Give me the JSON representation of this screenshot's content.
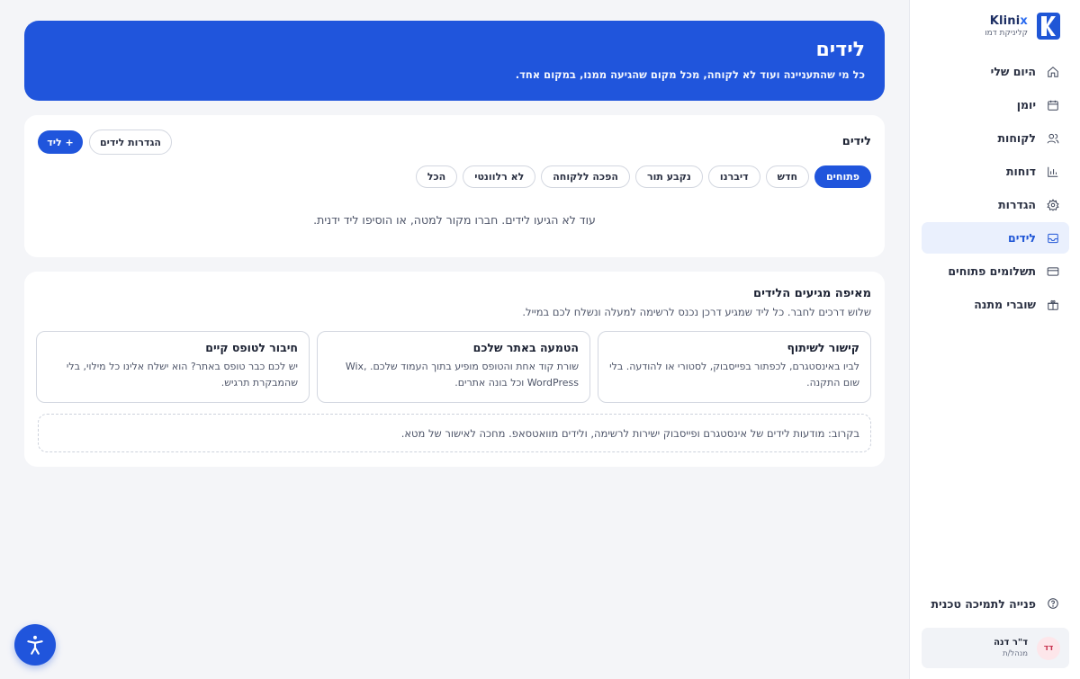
{
  "brand": {
    "name_main": "Klini",
    "name_accent": "x",
    "subtitle": "קליניקת דמו"
  },
  "sidebar": {
    "items": [
      {
        "label": "היום שלי",
        "icon": "home-icon",
        "active": false
      },
      {
        "label": "יומן",
        "icon": "calendar-icon",
        "active": false
      },
      {
        "label": "לקוחות",
        "icon": "users-icon",
        "active": false
      },
      {
        "label": "דוחות",
        "icon": "bar-chart-icon",
        "active": false
      },
      {
        "label": "הגדרות",
        "icon": "gear-icon",
        "active": false
      },
      {
        "label": "לידים",
        "icon": "inbox-icon",
        "active": true
      },
      {
        "label": "תשלומים פתוחים",
        "icon": "credit-card-icon",
        "active": false
      },
      {
        "label": "שוברי מתנה",
        "icon": "gift-icon",
        "active": false
      }
    ],
    "support_label": "פנייה לתמיכה טכנית",
    "user": {
      "initials": "דד",
      "name": "ד\"ר דנה",
      "role": "מנהל/ת"
    }
  },
  "hero": {
    "title": "לידים",
    "subtitle": "כל מי שהתעניינה ועוד לא לקוחה, מכל מקום שהגיעה ממנו, במקום אחד."
  },
  "leads": {
    "title": "לידים",
    "settings_label": "הגדרות לידים",
    "add_label": "+ ליד",
    "filters": [
      {
        "label": "פתוחים",
        "active": true
      },
      {
        "label": "חדש",
        "active": false
      },
      {
        "label": "דיברנו",
        "active": false
      },
      {
        "label": "נקבע תור",
        "active": false
      },
      {
        "label": "הפכה ללקוחה",
        "active": false
      },
      {
        "label": "לא רלוונטי",
        "active": false
      },
      {
        "label": "הכל",
        "active": false
      }
    ],
    "empty_message": "עוד לא הגיעו לידים. חברו מקור למטה, או הוסיפו ליד ידנית."
  },
  "sources": {
    "title": "מאיפה מגיעים הלידים",
    "subtitle": "שלוש דרכים לחבר. כל ליד שמגיע דרכן נכנס לרשימה למעלה ונשלח לכם במייל.",
    "cards": [
      {
        "title": "קישור לשיתוף",
        "text": "לביו באינסטגרם, לכפתור בפייסבוק, לסטורי או להודעה. בלי שום התקנה."
      },
      {
        "title": "הטמעה באתר שלכם",
        "text": "שורת קוד אחת והטופס מופיע בתוך העמוד שלכם. Wix, WordPress וכל בונה אתרים."
      },
      {
        "title": "חיבור לטופס קיים",
        "text": "יש לכם כבר טופס באתר? הוא ישלח אלינו כל מילוי, בלי שהמבקרת תרגיש."
      }
    ],
    "coming_soon": "בקרוב: מודעות לידים של אינסטגרם ופייסבוק ישירות לרשימה, ולידים מוואטסאפ. מחכה לאישור של מטא."
  },
  "accessibility": {
    "icon": "accessibility-icon"
  },
  "colors": {
    "primary": "#2055dc",
    "active_bg": "#eaf0fd",
    "avatar_bg": "#fde6ea"
  }
}
